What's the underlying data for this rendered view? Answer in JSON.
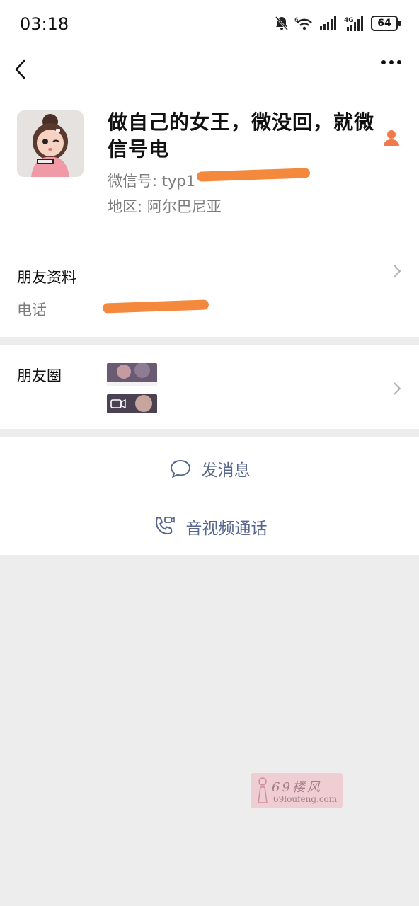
{
  "status_bar": {
    "time": "03:18",
    "battery": "64",
    "icons": [
      "bell-off-icon",
      "wifi-icon",
      "signal-icon",
      "4g-signal-icon",
      "battery-icon"
    ]
  },
  "profile": {
    "name": "做自己的女王，微没回，就微信号电",
    "wechat_id_label": "微信号: typ1",
    "region_label": "地区: ",
    "region": "阿尔巴尼亚"
  },
  "friend_info": {
    "title": "朋友资料",
    "phone_label": "电话"
  },
  "moments": {
    "title": "朋友圈"
  },
  "actions": {
    "send_message": "发消息",
    "av_call": "音视频通话"
  },
  "watermark": {
    "text": "69楼风",
    "url": "69loufeng.com"
  },
  "colors": {
    "accent_text": "#56668c",
    "redaction": "#f4883c",
    "background": "#ededed"
  }
}
